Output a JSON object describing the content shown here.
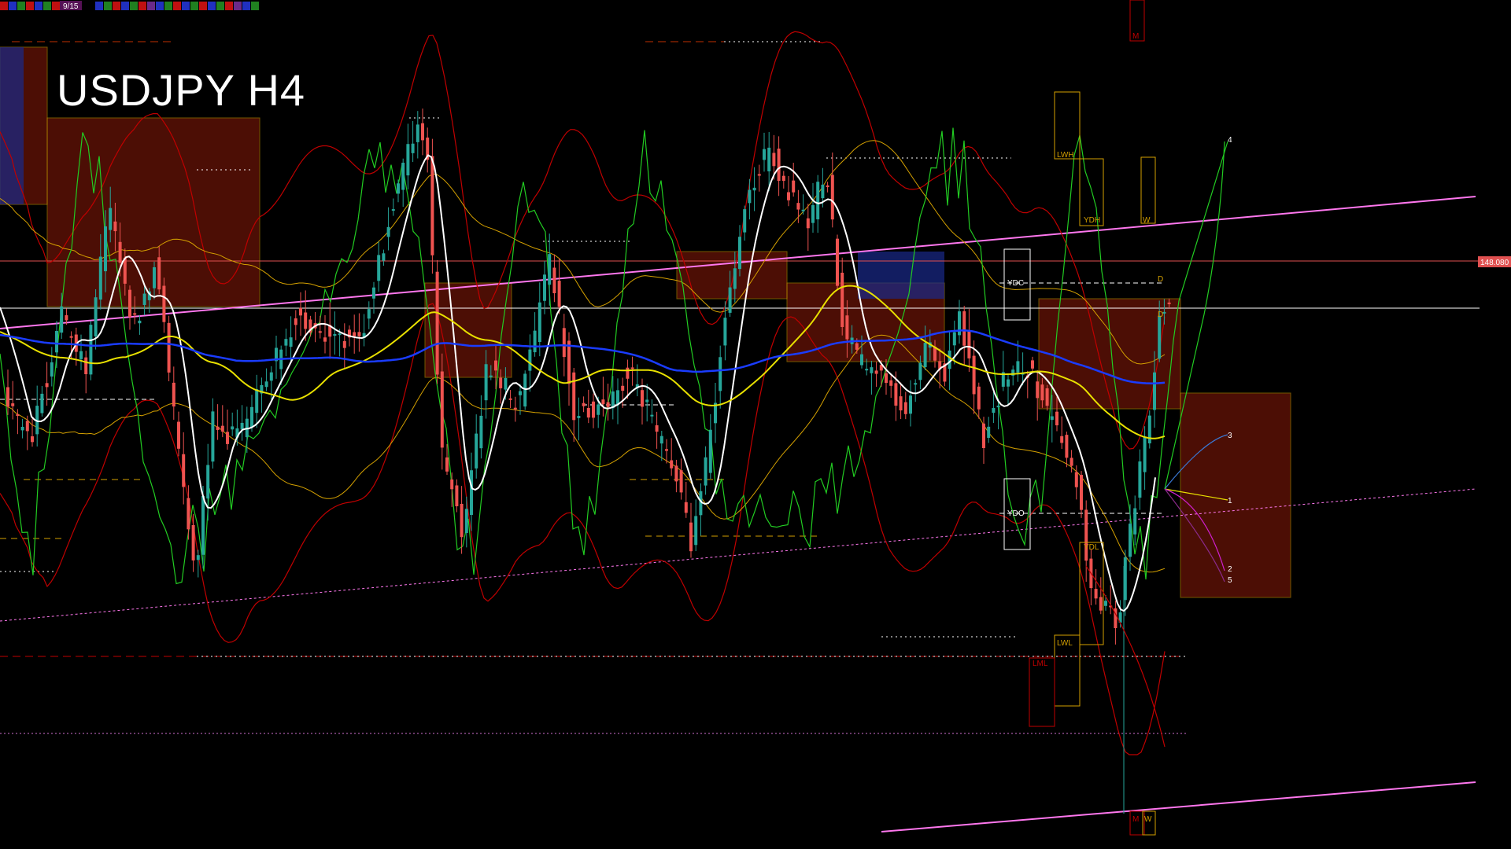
{
  "window": {
    "title": "USDJPY H4"
  },
  "price_tag": {
    "value": "148.080",
    "color": "#e05050"
  },
  "statusbar": {
    "page": "9/15"
  },
  "colors": {
    "bull": "#26a69a",
    "bear": "#ef5350",
    "ma_white": "#ffffff",
    "ma_yellow": "#e8e000",
    "ma_blue": "#1a3cff",
    "envelope_red": "#c00000",
    "oscillator_green": "#22cc22",
    "cloud_fill": "#8b1a0a",
    "cloud_edge": "#d4a000",
    "trendline": "#ff77ee"
  },
  "levels": {
    "ydc": "YDC",
    "ydo": "YDO",
    "ydh": "YDH",
    "ydl": "YDL",
    "lwh": "LWH",
    "lwl": "LWL",
    "lml": "LML",
    "w_top": "W",
    "w_bottom": "W",
    "m_top": "M",
    "m_bottom": "M",
    "d_top": "D",
    "d_mid": "D"
  },
  "projection_labels": [
    "4",
    "3",
    "1",
    "2",
    "5"
  ],
  "chart_data": {
    "type": "candlestick",
    "symbol": "USDJPY",
    "timeframe": "H4",
    "last_price": 148.08,
    "indicators": [
      "moving averages",
      "envelope bands",
      "ichimoku cloud",
      "oscillator",
      "trend lines",
      "daily/weekly levels"
    ]
  }
}
